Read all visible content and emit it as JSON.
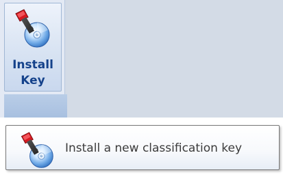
{
  "ribbon": {
    "install_key_button": {
      "label_line1": "Install",
      "label_line2": "Key",
      "icon": "key-cd-icon"
    }
  },
  "tooltip": {
    "text": "Install a new classification key",
    "icon": "key-cd-icon"
  },
  "colors": {
    "label_text": "#15428b",
    "ribbon_background": "#d3dbe6",
    "tooltip_text": "#3b3b3b"
  }
}
